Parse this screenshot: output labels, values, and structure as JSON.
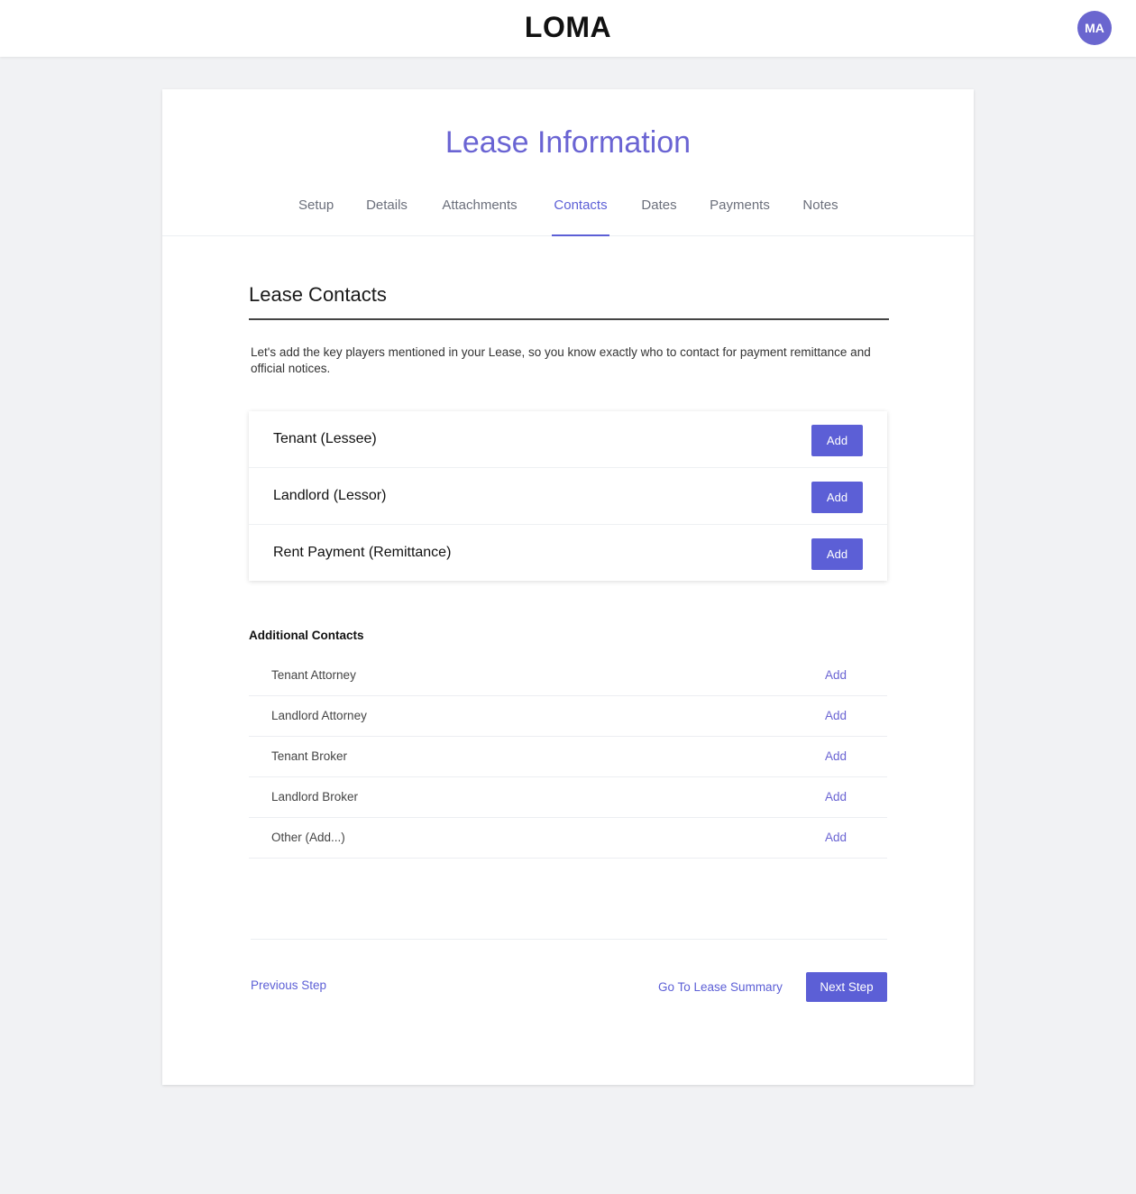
{
  "header": {
    "logo": "LOMA",
    "avatar_initials": "MA"
  },
  "page": {
    "title": "Lease Information"
  },
  "tabs": [
    {
      "label": "Setup",
      "active": false
    },
    {
      "label": "Details",
      "active": false
    },
    {
      "label": "Attachments",
      "active": false
    },
    {
      "label": "Contacts",
      "active": true
    },
    {
      "label": "Dates",
      "active": false
    },
    {
      "label": "Payments",
      "active": false
    },
    {
      "label": "Notes",
      "active": false
    }
  ],
  "section": {
    "title": "Lease Contacts",
    "intro": "Let's add the key players mentioned in your Lease, so you know exactly who to contact for payment remittance and official notices."
  },
  "primary_contacts": [
    {
      "label": "Tenant (Lessee)",
      "action": "Add"
    },
    {
      "label": "Landlord (Lessor)",
      "action": "Add"
    },
    {
      "label": "Rent Payment (Remittance)",
      "action": "Add"
    }
  ],
  "additional": {
    "title": "Additional Contacts",
    "items": [
      {
        "label": "Tenant Attorney",
        "action": "Add"
      },
      {
        "label": "Landlord Attorney",
        "action": "Add"
      },
      {
        "label": "Tenant Broker",
        "action": "Add"
      },
      {
        "label": "Landlord Broker",
        "action": "Add"
      },
      {
        "label": "Other (Add...)",
        "action": "Add"
      }
    ]
  },
  "footer": {
    "previous": "Previous Step",
    "summary": "Go To Lease Summary",
    "next": "Next Step"
  },
  "colors": {
    "accent": "#5c5fd6",
    "title": "#6a64d3",
    "avatar": "#6a66cf",
    "background": "#f1f2f4"
  }
}
